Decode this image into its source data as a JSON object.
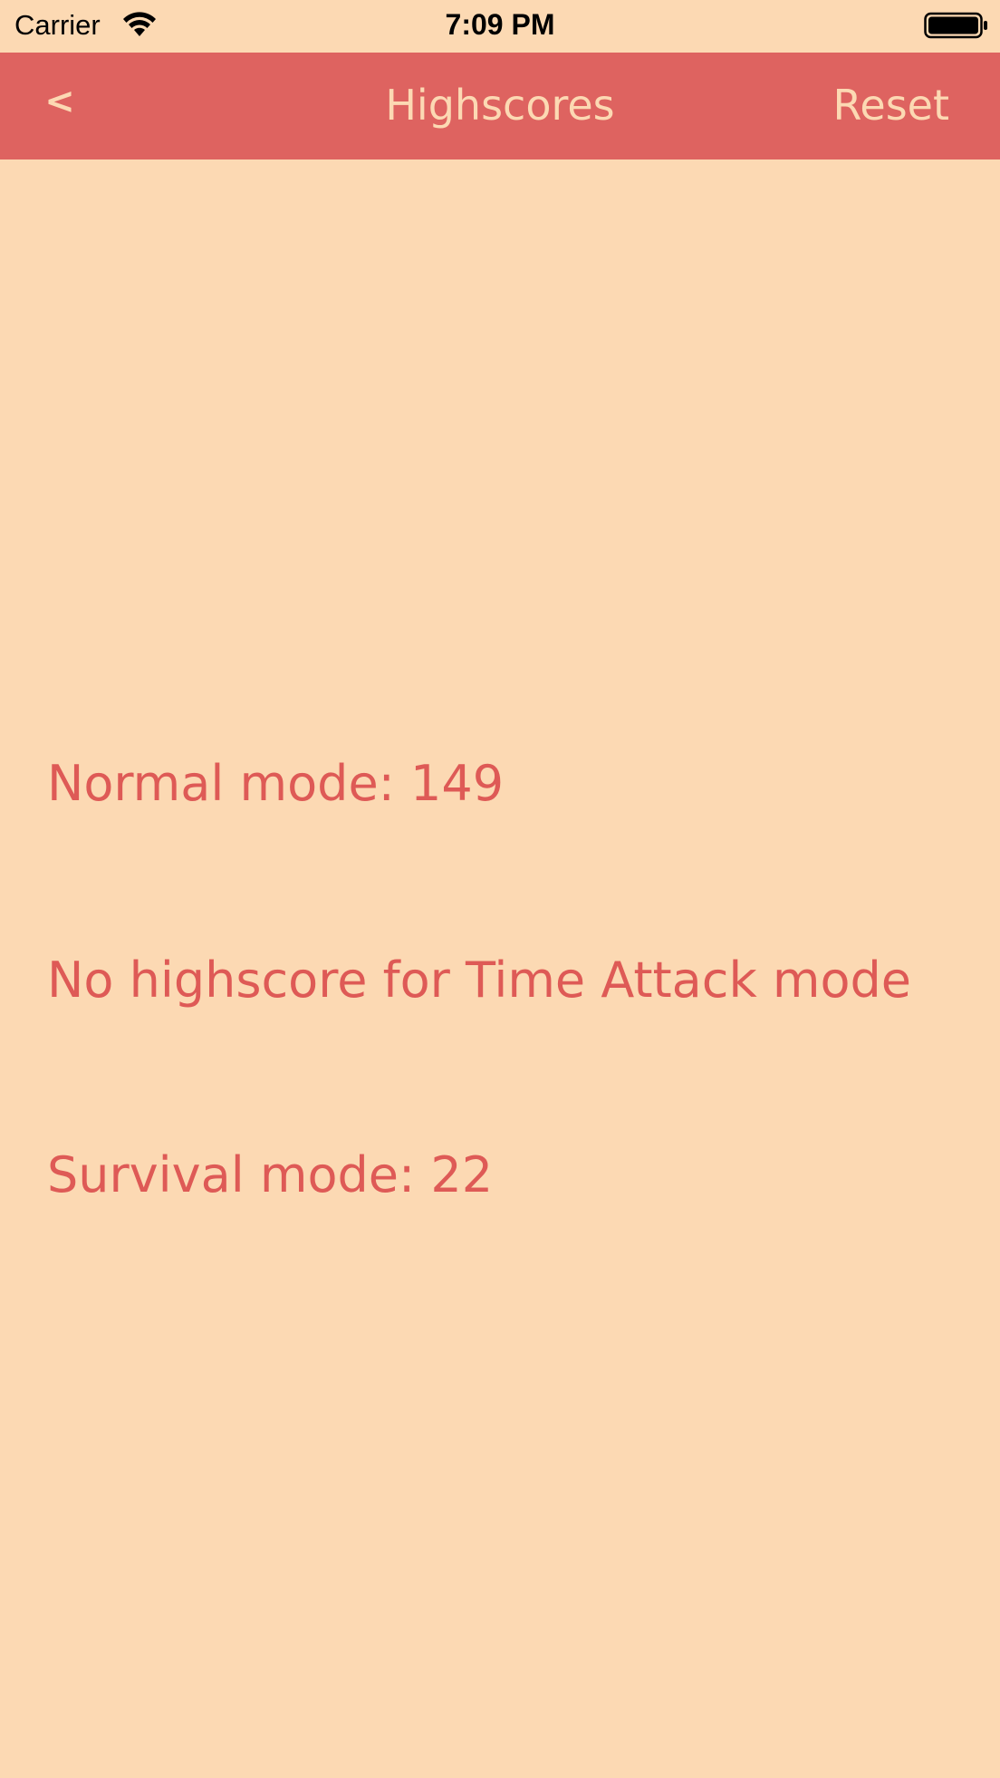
{
  "status_bar": {
    "carrier": "Carrier",
    "time": "7:09 PM",
    "wifi_icon": "wifi-icon",
    "battery_icon": "battery-icon"
  },
  "nav": {
    "back_label": "<",
    "title": "Highscores",
    "reset_label": "Reset",
    "background_color": "#DE6360",
    "text_color": "#FCD9B3"
  },
  "scores": {
    "normal": "Normal mode: 149",
    "time_attack": "No highscore for Time Attack mode",
    "survival": "Survival mode: 22",
    "text_color": "#DE5A56"
  },
  "page": {
    "background_color": "#FCD9B3"
  }
}
